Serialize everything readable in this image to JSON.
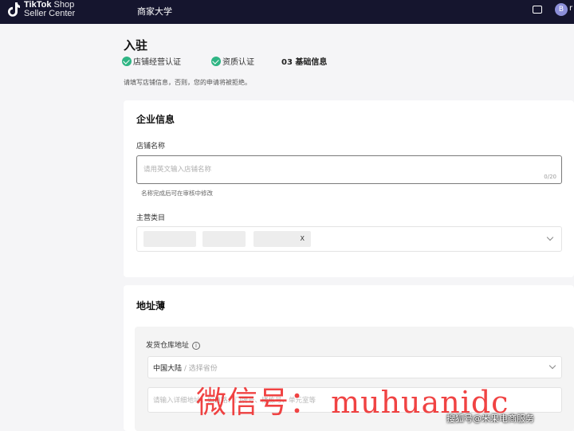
{
  "header": {
    "logo_primary": "TikTok",
    "logo_secondary": "Shop",
    "logo_line2": "Seller Center",
    "nav_item": "商家大学",
    "avatar_letter": "B",
    "avatar_extra": "r"
  },
  "page": {
    "title": "入驻",
    "steps": [
      {
        "label": "店铺经营认证",
        "status": "done"
      },
      {
        "label": "资质认证",
        "status": "done"
      },
      {
        "label": "03 基础信息",
        "status": "current"
      }
    ],
    "intro": "请填写店铺信息，否则，您的申请将被拒绝。"
  },
  "company": {
    "section_title": "企业信息",
    "shop_name_label": "店铺名称",
    "shop_name_placeholder": "请用英文输入店铺名称",
    "shop_name_counter": "0/20",
    "shop_name_helper": "名称完成后可在审核中修改",
    "category_label": "主营类目",
    "chips": [
      "",
      "",
      "",
      "X"
    ]
  },
  "address": {
    "section_title": "地址薄",
    "warehouse_label": "发货仓库地址",
    "region_value": "中国大陆",
    "region_sub": "/ 选择省份",
    "detail_placeholder": "请输入详细地址，如道路、门牌号、楼栋号、单元室等"
  },
  "overlay": {
    "watermark": "微信号： muhuanidc",
    "credit": "搜狐号@米果电商服务"
  },
  "colors": {
    "topbar": "#15152e",
    "success": "#2fb584",
    "watermark": "#ee2a2a"
  }
}
